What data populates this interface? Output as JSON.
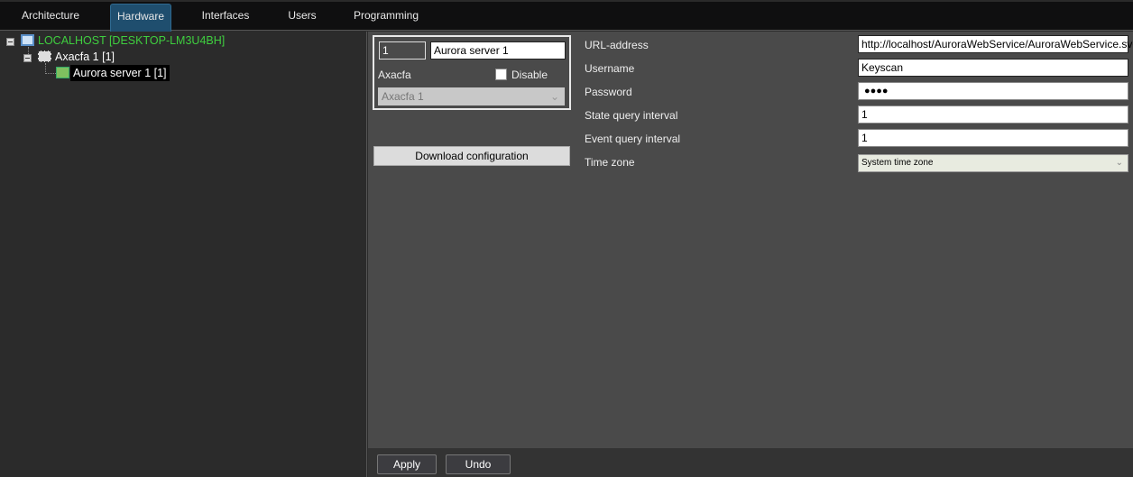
{
  "tabs": [
    {
      "label": "Architecture"
    },
    {
      "label": "Hardware"
    },
    {
      "label": "Interfaces"
    },
    {
      "label": "Users"
    },
    {
      "label": "Programming"
    }
  ],
  "tree": {
    "root": "LOCALHOST [DESKTOP-LM3U4BH]",
    "child": "Axacfa 1 [1]",
    "leaf": "Aurora server 1 [1]"
  },
  "object": {
    "id": "1",
    "name": "Aurora server 1",
    "type_label": "Axacfa",
    "disable_label": "Disable",
    "disabled": false,
    "parent_select": "Axacfa 1",
    "download_button": "Download configuration"
  },
  "settings": {
    "url_label": "URL-address",
    "url": "http://localhost/AuroraWebService/AuroraWebService.svc",
    "username_label": "Username",
    "username": "Keyscan",
    "password_label": "Password",
    "password": "●●●●",
    "state_label": "State query interval",
    "state": "1",
    "event_label": "Event query interval",
    "event": "1",
    "timezone_label": "Time zone",
    "timezone": "System time zone"
  },
  "footer": {
    "apply": "Apply",
    "undo": "Undo"
  }
}
